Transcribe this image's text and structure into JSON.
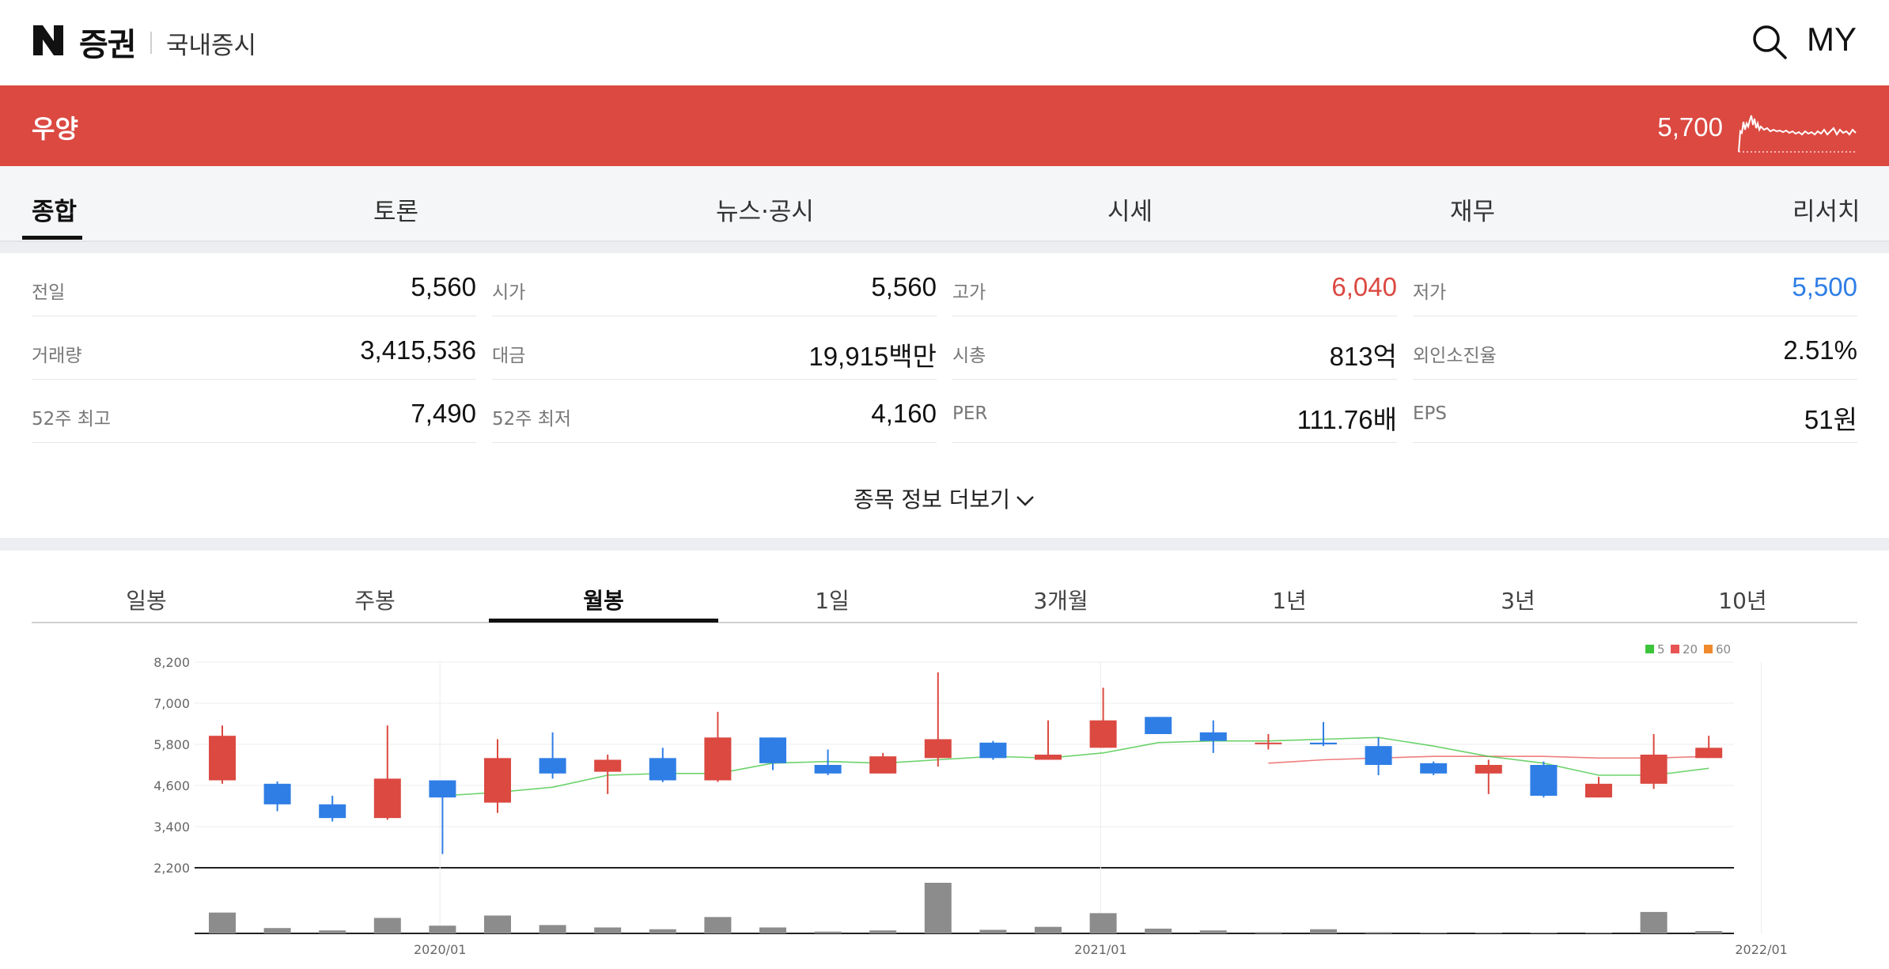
{
  "header": {
    "logo_letter": "N",
    "logo_text": "증권",
    "section": "국내증시",
    "my_label": "MY"
  },
  "stock": {
    "name": "우양",
    "price": "5,700"
  },
  "tabs": [
    "종합",
    "토론",
    "뉴스·공시",
    "시세",
    "재무",
    "리서치"
  ],
  "info": [
    {
      "label": "전일",
      "value": "5,560",
      "color": ""
    },
    {
      "label": "시가",
      "value": "5,560",
      "color": ""
    },
    {
      "label": "고가",
      "value": "6,040",
      "color": "red"
    },
    {
      "label": "저가",
      "value": "5,500",
      "color": "blue"
    },
    {
      "label": "거래량",
      "value": "3,415,536",
      "color": ""
    },
    {
      "label": "대금",
      "value": "19,915백만",
      "color": ""
    },
    {
      "label": "시총",
      "value": "813억",
      "color": ""
    },
    {
      "label": "외인소진율",
      "value": "2.51%",
      "color": ""
    },
    {
      "label": "52주 최고",
      "value": "7,490",
      "color": ""
    },
    {
      "label": "52주 최저",
      "value": "4,160",
      "color": ""
    },
    {
      "label": "PER",
      "value": "111.76배",
      "color": ""
    },
    {
      "label": "EPS",
      "value": "51원",
      "color": ""
    }
  ],
  "more_label": "종목 정보 더보기",
  "period_tabs": [
    "일봉",
    "주봉",
    "월봉",
    "1일",
    "3개월",
    "1년",
    "3년",
    "10년"
  ],
  "colors": {
    "up": "#db4941",
    "down": "#2f7ee6",
    "brand_bar": "#db4941",
    "volume": "#8c8c8c",
    "ma5": "#3cc43c",
    "ma20": "#e85353",
    "ma60": "#f08a2c"
  },
  "chart_data": {
    "type": "candlestick",
    "y_ticks": [
      "8,200",
      "7,000",
      "5,800",
      "4,600",
      "3,400",
      "2,200"
    ],
    "ylim": [
      2200,
      8200
    ],
    "x_ticks": [
      {
        "label": "2020/01",
        "index": 2
      },
      {
        "label": "2021/01",
        "index": 14
      },
      {
        "label": "2022/01",
        "index": 26
      }
    ],
    "legend": [
      "5",
      "20",
      "60"
    ],
    "candles": [
      {
        "o": 4750,
        "h": 6350,
        "l": 4650,
        "c": 6050,
        "v": 70
      },
      {
        "o": 4650,
        "h": 4720,
        "l": 3850,
        "c": 4050,
        "v": 18
      },
      {
        "o": 4050,
        "h": 4300,
        "l": 3550,
        "c": 3650,
        "v": 10
      },
      {
        "o": 3650,
        "h": 6350,
        "l": 3600,
        "c": 4800,
        "v": 52
      },
      {
        "o": 4750,
        "h": 4750,
        "l": 2600,
        "c": 4250,
        "v": 26
      },
      {
        "o": 4100,
        "h": 5950,
        "l": 3800,
        "c": 5400,
        "v": 60
      },
      {
        "o": 5400,
        "h": 6150,
        "l": 4800,
        "c": 4950,
        "v": 28
      },
      {
        "o": 5000,
        "h": 5500,
        "l": 4350,
        "c": 5350,
        "v": 20
      },
      {
        "o": 5400,
        "h": 5700,
        "l": 4700,
        "c": 4750,
        "v": 14
      },
      {
        "o": 4750,
        "h": 6750,
        "l": 4700,
        "c": 6000,
        "v": 55
      },
      {
        "o": 6000,
        "h": 6000,
        "l": 5050,
        "c": 5250,
        "v": 20
      },
      {
        "o": 5200,
        "h": 5650,
        "l": 4900,
        "c": 4950,
        "v": 6
      },
      {
        "o": 4950,
        "h": 5550,
        "l": 4950,
        "c": 5450,
        "v": 10
      },
      {
        "o": 5400,
        "h": 7900,
        "l": 5150,
        "c": 5950,
        "v": 170
      },
      {
        "o": 5850,
        "h": 5900,
        "l": 5350,
        "c": 5400,
        "v": 12
      },
      {
        "o": 5350,
        "h": 6500,
        "l": 5350,
        "c": 5500,
        "v": 22
      },
      {
        "o": 5700,
        "h": 7450,
        "l": 5700,
        "c": 6500,
        "v": 68
      },
      {
        "o": 6600,
        "h": 6600,
        "l": 6100,
        "c": 6100,
        "v": 16
      },
      {
        "o": 6150,
        "h": 6500,
        "l": 5550,
        "c": 5900,
        "v": 10
      },
      {
        "o": 5850,
        "h": 6100,
        "l": 5650,
        "c": 5850,
        "v": 4
      },
      {
        "o": 5850,
        "h": 6450,
        "l": 5750,
        "c": 5800,
        "v": 14
      },
      {
        "o": 5750,
        "h": 6000,
        "l": 4900,
        "c": 5200,
        "v": 4
      },
      {
        "o": 5250,
        "h": 5300,
        "l": 4900,
        "c": 4950,
        "v": 2
      },
      {
        "o": 4950,
        "h": 5350,
        "l": 4350,
        "c": 5200,
        "v": 2
      },
      {
        "o": 5200,
        "h": 5300,
        "l": 4250,
        "c": 4300,
        "v": 2
      },
      {
        "o": 4250,
        "h": 4850,
        "l": 4250,
        "c": 4650,
        "v": 2
      },
      {
        "o": 4650,
        "h": 6100,
        "l": 4500,
        "c": 5500,
        "v": 72
      },
      {
        "o": 5400,
        "h": 6050,
        "l": 5400,
        "c": 5700,
        "v": 8
      }
    ],
    "ma5": [
      null,
      null,
      null,
      null,
      4300,
      4400,
      4550,
      4900,
      4950,
      4950,
      5250,
      5300,
      5250,
      5350,
      5450,
      5400,
      5550,
      5850,
      5900,
      5900,
      5950,
      6000,
      5750,
      5450,
      5250,
      4900,
      4900,
      5100
    ],
    "ma20": [
      null,
      null,
      null,
      null,
      null,
      null,
      null,
      null,
      null,
      null,
      null,
      null,
      null,
      null,
      null,
      null,
      null,
      null,
      null,
      5250,
      5350,
      5400,
      5450,
      5450,
      5450,
      5400,
      5400,
      5450
    ]
  }
}
